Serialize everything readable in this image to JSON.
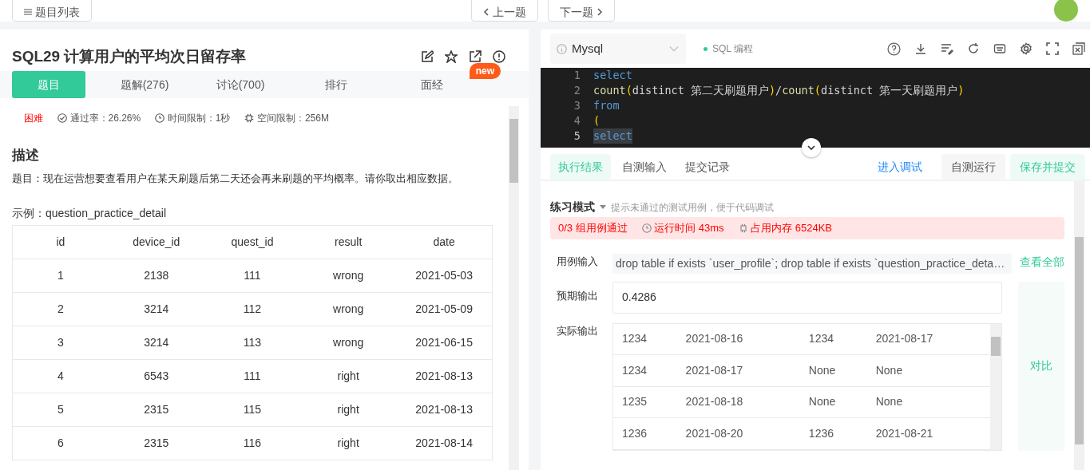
{
  "top_bar": {
    "list_button": "题目列表",
    "prev_button": "上一题",
    "next_button": "下一题"
  },
  "problem": {
    "title": "SQL29  计算用户的平均次日留存率",
    "tabs": [
      {
        "label": "题目",
        "selected": true
      },
      {
        "label": "题解(276)",
        "selected": false
      },
      {
        "label": "讨论(700)",
        "selected": false
      },
      {
        "label": "排行",
        "selected": false
      },
      {
        "label": "面经",
        "selected": false,
        "badge": "new"
      }
    ],
    "difficulty": "困难",
    "pass_rate": "通过率：26.26%",
    "time_limit": "时间限制：1秒",
    "space_limit": "空间限制：256M",
    "section_heading": "描述",
    "description": "题目：现在运营想要查看用户在某天刷题后第二天还会再来刷题的平均概率。请你取出相应数据。",
    "example_label": "示例：question_practice_detail",
    "table": {
      "columns": [
        "id",
        "device_id",
        "quest_id",
        "result",
        "date"
      ],
      "rows": [
        [
          "1",
          "2138",
          "111",
          "wrong",
          "2021-05-03"
        ],
        [
          "2",
          "3214",
          "112",
          "wrong",
          "2021-05-09"
        ],
        [
          "3",
          "3214",
          "113",
          "wrong",
          "2021-06-15"
        ],
        [
          "4",
          "6543",
          "111",
          "right",
          "2021-08-13"
        ],
        [
          "5",
          "2315",
          "115",
          "right",
          "2021-08-13"
        ],
        [
          "6",
          "2315",
          "116",
          "right",
          "2021-08-14"
        ]
      ]
    }
  },
  "editor": {
    "language": "Mysql",
    "mode_label": "SQL 编程",
    "lines": [
      {
        "number": "1",
        "current": false,
        "tokens": [
          {
            "kind": "kw",
            "text": "select"
          }
        ]
      },
      {
        "number": "2",
        "current": false,
        "tokens": [
          {
            "kind": "fn",
            "text": "count"
          },
          {
            "kind": "paren",
            "text": "("
          },
          {
            "kind": "plain",
            "text": "distinct 第二天刷题用户"
          },
          {
            "kind": "paren",
            "text": ")"
          },
          {
            "kind": "plain",
            "text": "/"
          },
          {
            "kind": "fn",
            "text": "count"
          },
          {
            "kind": "paren",
            "text": "("
          },
          {
            "kind": "plain",
            "text": "distinct 第一天刷题用户"
          },
          {
            "kind": "paren",
            "text": ")"
          }
        ]
      },
      {
        "number": "3",
        "current": false,
        "tokens": [
          {
            "kind": "kw",
            "text": "from"
          }
        ]
      },
      {
        "number": "4",
        "current": false,
        "tokens": [
          {
            "kind": "paren",
            "text": "("
          }
        ]
      },
      {
        "number": "5",
        "current": true,
        "tokens": [
          {
            "kind": "kw",
            "text": "select"
          }
        ]
      }
    ]
  },
  "result": {
    "tabs": [
      {
        "label": "执行结果",
        "selected": true
      },
      {
        "label": "自测输入",
        "selected": false
      },
      {
        "label": "提交记录",
        "selected": false
      }
    ],
    "debug_link": "进入调试",
    "run_button": "自测运行",
    "submit_button": "保存并提交",
    "mode": "练习模式",
    "mode_hint": "提示未通过的测试用例，便于代码调试",
    "status": {
      "passed": "0/3 组用例通过",
      "runtime": "运行时间 43ms",
      "memory": "占用内存 6524KB"
    },
    "case_input_label": "用例输入",
    "case_input": "drop table if exists `user_profile`; drop table if exists `question_practice_deta…",
    "view_all": "查看全部",
    "expected_label": "预期输出",
    "expected": "0.4286",
    "actual_label": "实际输出",
    "actual_rows": [
      [
        "1234",
        "2021-08-16",
        "1234",
        "2021-08-17"
      ],
      [
        "1234",
        "2021-08-17",
        "None",
        "None"
      ],
      [
        "1235",
        "2021-08-18",
        "None",
        "None"
      ],
      [
        "1236",
        "2021-08-20",
        "1236",
        "2021-08-21"
      ]
    ],
    "compare_button": "对比"
  }
}
